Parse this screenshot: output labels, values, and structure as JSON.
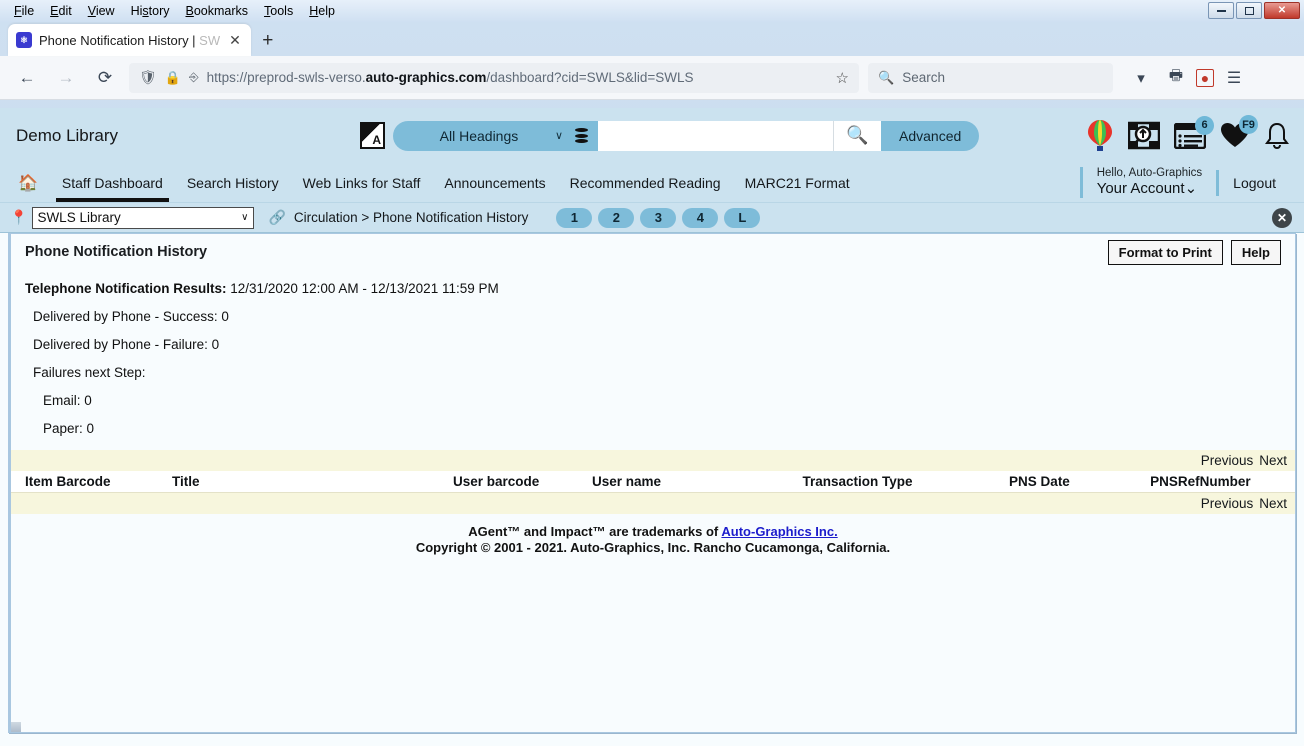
{
  "os": {
    "menus": [
      "File",
      "Edit",
      "View",
      "History",
      "Bookmarks",
      "Tools",
      "Help"
    ],
    "window_controls": {
      "minimize": "—",
      "restore": "❐",
      "close": "✕"
    }
  },
  "browser": {
    "tab": {
      "title": "Phone Notification History | ",
      "title_dim": "SW",
      "close": "✕"
    },
    "new_tab": "+",
    "nav": {
      "back": "←",
      "forward": "→",
      "reload": "⟳"
    },
    "url": {
      "protocol": "https://preprod-swls-verso.",
      "domain": "auto-graphics.com",
      "path": "/dashboard?cid=SWLS&lid=SWLS"
    },
    "search_placeholder": "Search",
    "bookmark_star": "☆"
  },
  "app": {
    "library_name": "Demo Library",
    "search": {
      "scope_label": "All Headings",
      "chevron": "∨",
      "input_value": "",
      "advanced_label": "Advanced"
    },
    "header_icons": [
      {
        "name": "balloon-icon",
        "badge": null
      },
      {
        "name": "image-search-icon",
        "badge": null
      },
      {
        "name": "list-card-icon",
        "badge": "6"
      },
      {
        "name": "favorites-heart-icon",
        "badge": "F9"
      },
      {
        "name": "notifications-bell-icon",
        "badge": null
      }
    ],
    "nav_links": [
      {
        "label": "Staff Dashboard",
        "active": true
      },
      {
        "label": "Search History",
        "active": false
      },
      {
        "label": "Web Links for Staff",
        "active": false
      },
      {
        "label": "Announcements",
        "active": false
      },
      {
        "label": "Recommended Reading",
        "active": false
      },
      {
        "label": "MARC21 Format",
        "active": false
      }
    ],
    "account": {
      "greeting": "Hello, Auto-Graphics",
      "name": "Your Account",
      "chevron": "⌄",
      "logout": "Logout"
    },
    "crumbbar": {
      "library_select": "SWLS Library",
      "select_chevron": "∨",
      "breadcrumb": "Circulation > Phone Notification History",
      "pills": [
        "1",
        "2",
        "3",
        "4",
        "L"
      ],
      "close": "✖"
    }
  },
  "panel": {
    "title": "Phone Notification History",
    "buttons": {
      "format_to_print": "Format to Print",
      "help": "Help"
    },
    "results_label": "Telephone Notification Results:",
    "results_range": "12/31/2020 12:00 AM - 12/13/2021 11:59 PM",
    "stats": [
      {
        "label": "Delivered by Phone - Success: 0",
        "indent": 1
      },
      {
        "label": "Delivered by Phone - Failure: 0",
        "indent": 1
      },
      {
        "label": "Failures next Step:",
        "indent": 1
      },
      {
        "label": "Email: 0",
        "indent": 2
      },
      {
        "label": "Paper: 0",
        "indent": 2
      }
    ],
    "pager": {
      "previous": "Previous",
      "next": "Next"
    },
    "table": {
      "columns": [
        "Item Barcode",
        "Title",
        "User barcode",
        "User name",
        "Transaction Type",
        "PNS Date",
        "PNSRefNumber"
      ],
      "rows": []
    }
  },
  "footer": {
    "trademark_pre": "AGent™ and Impact™ are trademarks of ",
    "trademark_link": "Auto-Graphics Inc.",
    "copyright": "Copyright © 2001 - 2021. Auto-Graphics, Inc. Rancho Cucamonga, California."
  },
  "colors": {
    "app_header_bg": "#cbe2ef",
    "accent_pill": "#7ebcd9",
    "pager_bg": "#f7f6dd",
    "link": "#1c1ccc"
  }
}
